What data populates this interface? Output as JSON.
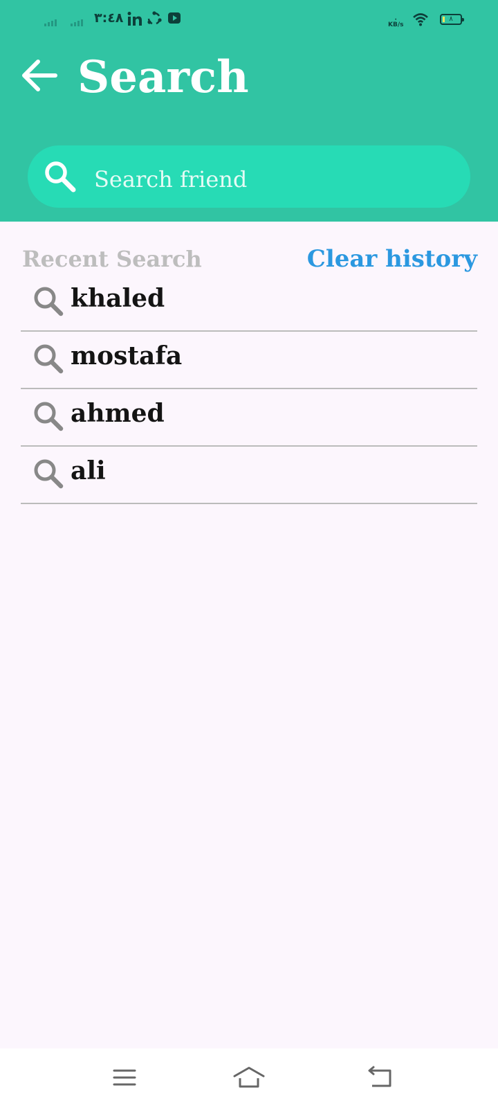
{
  "status_bar": {
    "time": "٣:٤٨",
    "icons": [
      "signal-bars-icon",
      "signal-bars-icon",
      "linkedin-icon",
      "share-it-icon",
      "youtube-icon",
      "wifi-icon",
      "battery-icon"
    ],
    "net_speed_unit": "KB/s",
    "net_speed_value": "·",
    "battery_level": "٨"
  },
  "header": {
    "title": "Search",
    "back_icon": "arrow-left-icon"
  },
  "search": {
    "placeholder": "Search friend",
    "value": "",
    "icon": "search-icon"
  },
  "recent": {
    "label": "Recent Search",
    "clear_label": "Clear history",
    "items": [
      {
        "label": "khaled",
        "icon": "search-icon"
      },
      {
        "label": "mostafa",
        "icon": "search-icon"
      },
      {
        "label": "ahmed",
        "icon": "search-icon"
      },
      {
        "label": "ali",
        "icon": "search-icon"
      }
    ]
  },
  "nav_bar": {
    "buttons": [
      "menu-icon",
      "home-icon",
      "back-icon"
    ]
  },
  "colors": {
    "header": "#31c4a3",
    "search_box": "#27dbb5",
    "accent": "#2b98e0",
    "background": "#fcf6fd"
  }
}
